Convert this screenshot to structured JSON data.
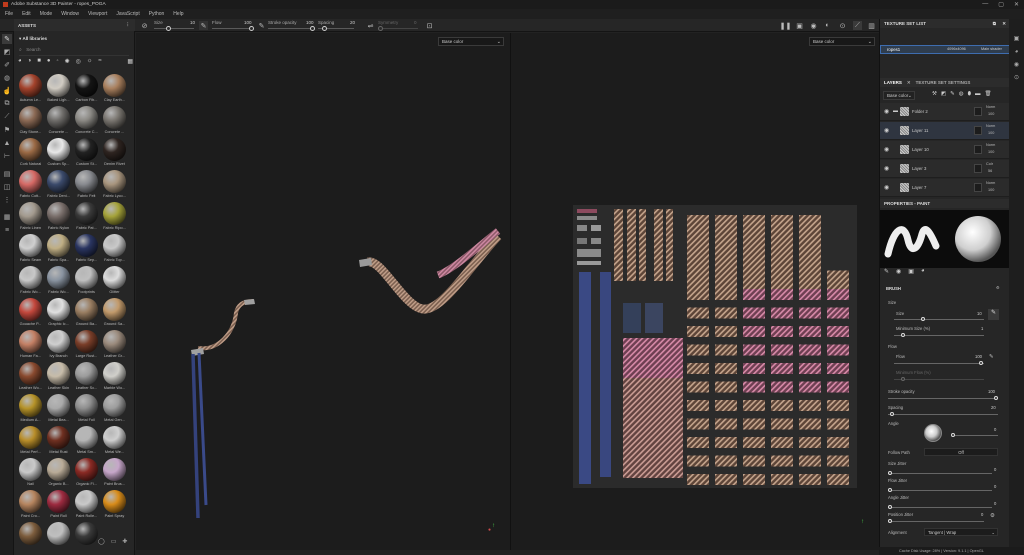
{
  "titlebar": {
    "title": "Adobe Substance 3D Painter - ropes_POGA",
    "controls": [
      "—",
      "▢",
      "✕"
    ]
  },
  "menubar": {
    "items": [
      "File",
      "Edit",
      "Mode",
      "Window",
      "Viewport",
      "JavaScript",
      "Python",
      "Help"
    ]
  },
  "toolbar": {
    "size_label": "Size",
    "size_value": "10",
    "flow_label": "Flow",
    "flow_value": "100",
    "stroke_label": "Stroke opacity",
    "stroke_value": "100",
    "spacing_label": "Spacing",
    "spacing_value": "20",
    "symmetry_label": "Symmetry",
    "symmetry_value": "0"
  },
  "assets": {
    "title": "ASSETS",
    "filter": "All libraries",
    "search_placeholder": "Search",
    "items": [
      {
        "label": "Autumn Le...",
        "color": "#a4432c"
      },
      {
        "label": "Baked Ligh...",
        "color": "#d0cbc2"
      },
      {
        "label": "Carbon Fib...",
        "color": "#141414"
      },
      {
        "label": "Clay Earth...",
        "color": "#a9805e"
      },
      {
        "label": "Clay Stone...",
        "color": "#8c6a55"
      },
      {
        "label": "Concrete ...",
        "color": "#6f6d6a"
      },
      {
        "label": "Concrete C...",
        "color": "#8c8a85"
      },
      {
        "label": "Concrete ...",
        "color": "#7b7771"
      },
      {
        "label": "Cork Natural",
        "color": "#9b6a45"
      },
      {
        "label": "Custom Sp...",
        "color": "#e8e8e8"
      },
      {
        "label": "Custom St...",
        "color": "#222222"
      },
      {
        "label": "Denim Rivet",
        "color": "#2e2420"
      },
      {
        "label": "Fabric Cott...",
        "color": "#d76a66"
      },
      {
        "label": "Fabric Deni...",
        "color": "#3b4a6b"
      },
      {
        "label": "Fabric Felt",
        "color": "#888a8f"
      },
      {
        "label": "Fabric Lyco...",
        "color": "#a8957e"
      },
      {
        "label": "Fabric Linen",
        "color": "#a39a8e"
      },
      {
        "label": "Fabric Nylon",
        "color": "#7a6f6b"
      },
      {
        "label": "Fabric Pat...",
        "color": "#3a3a3a"
      },
      {
        "label": "Fabric Ripo...",
        "color": "#a5a33a"
      },
      {
        "label": "Fabric Seam",
        "color": "#cfcfcf"
      },
      {
        "label": "Fabric Spa...",
        "color": "#bfae84"
      },
      {
        "label": "Fabric Sep...",
        "color": "#2a3561"
      },
      {
        "label": "Fabric Top...",
        "color": "#c9c9c9"
      },
      {
        "label": "Fabric Wo...",
        "color": "#c8c8c8"
      },
      {
        "label": "Fabric Wo...",
        "color": "#8993a0"
      },
      {
        "label": "Footprints",
        "color": "#bfbfbf"
      },
      {
        "label": "Glitter",
        "color": "#dddddd"
      },
      {
        "label": "Gouache P...",
        "color": "#c4483d"
      },
      {
        "label": "Graphic Ic...",
        "color": "#e0e0e0"
      },
      {
        "label": "Ground Ba...",
        "color": "#9a7e62"
      },
      {
        "label": "Ground Sa...",
        "color": "#c29a6b"
      },
      {
        "label": "Human Fa...",
        "color": "#c48065"
      },
      {
        "label": "Ivy Branch",
        "color": "#cfcfcf"
      },
      {
        "label": "Large Rust...",
        "color": "#7a3e29"
      },
      {
        "label": "Leather Gr...",
        "color": "#9a8a7c"
      },
      {
        "label": "Leather Wo...",
        "color": "#8a4a2f"
      },
      {
        "label": "Leather Skin",
        "color": "#c7bca9"
      },
      {
        "label": "Leather Sc...",
        "color": "#9c9c9c"
      },
      {
        "label": "Marble Wo...",
        "color": "#d0cfca"
      },
      {
        "label": "Medium A...",
        "color": "#b69329"
      },
      {
        "label": "Metal Bea...",
        "color": "#a9a9a9"
      },
      {
        "label": "Metal Foil",
        "color": "#8e8e8e"
      },
      {
        "label": "Metal Gen...",
        "color": "#9d9d9d"
      },
      {
        "label": "Metal Perf...",
        "color": "#b98e2a"
      },
      {
        "label": "Metal Rust",
        "color": "#6f3021"
      },
      {
        "label": "Metal Sm...",
        "color": "#b5b5b5"
      },
      {
        "label": "Metal We...",
        "color": "#cfcfcf"
      },
      {
        "label": "Nail",
        "color": "#c9c9c9"
      },
      {
        "label": "Organic B...",
        "color": "#b9ab97"
      },
      {
        "label": "Organic Fl...",
        "color": "#8a2a24"
      },
      {
        "label": "Paint Brus...",
        "color": "#c6a6c9"
      },
      {
        "label": "Paint Cro...",
        "color": "#b6855f"
      },
      {
        "label": "Paint Roll",
        "color": "#9d2b40"
      },
      {
        "label": "Paint Rolle...",
        "color": "#c9c9c9"
      },
      {
        "label": "Paint Spray",
        "color": "#d88c1a"
      },
      {
        "label": "",
        "color": "#7d5d3d"
      },
      {
        "label": "",
        "color": "#bfbfbf"
      },
      {
        "label": "",
        "color": "#3a3a3a"
      }
    ]
  },
  "viewport3d": {
    "channel": "Base color"
  },
  "viewport2d": {
    "channel": "Base color"
  },
  "texture_set_list": {
    "title": "TEXTURE SET LIST",
    "name": "ropes1",
    "resolution": "4096x4096",
    "shader": "Main shader"
  },
  "layers": {
    "tab1": "LAYERS",
    "tab2": "TEXTURE SET SETTINGS",
    "channel": "Base color",
    "items": [
      {
        "name": "Folder 2",
        "blend": "Norm",
        "opacity": "100",
        "folder": true
      },
      {
        "name": "Layer 11",
        "blend": "Norm",
        "opacity": "100",
        "folder": false
      },
      {
        "name": "Layer 10",
        "blend": "Norm",
        "opacity": "100",
        "folder": false
      },
      {
        "name": "Layer 3",
        "blend": "Colr",
        "opacity": "56",
        "folder": false
      },
      {
        "name": "Layer 7",
        "blend": "Norm",
        "opacity": "100",
        "folder": false
      }
    ]
  },
  "properties": {
    "title": "PROPERTIES - PAINT",
    "brush_title": "BRUSH",
    "size_section": "Size",
    "size_label": "Size",
    "size_value": "10",
    "min_size_label": "Minimum Size (%)",
    "min_size_value": "1",
    "flow_section": "Flow",
    "flow_label": "Flow",
    "flow_value": "100",
    "min_flow_label": "Minimum Flow (%)",
    "stroke_label": "Stroke opacity",
    "stroke_value": "100",
    "spacing_label": "Spacing",
    "spacing_value": "20",
    "angle_label": "Angle",
    "angle_value": "0",
    "follow_path_label": "Follow Path",
    "follow_path_value": "Off",
    "size_jitter_label": "Size Jitter",
    "size_jitter_value": "0",
    "flow_jitter_label": "Flow Jitter",
    "flow_jitter_value": "0",
    "angle_jitter_label": "Angle Jitter",
    "angle_jitter_value": "0",
    "position_jitter_label": "Position Jitter",
    "position_jitter_value": "0",
    "alignment_label": "Alignment",
    "alignment_value": "Tangent | Wrap"
  },
  "status": {
    "text": "Cache Disk Usage: 28% | Version: 9.1.1 | OpenGL"
  }
}
